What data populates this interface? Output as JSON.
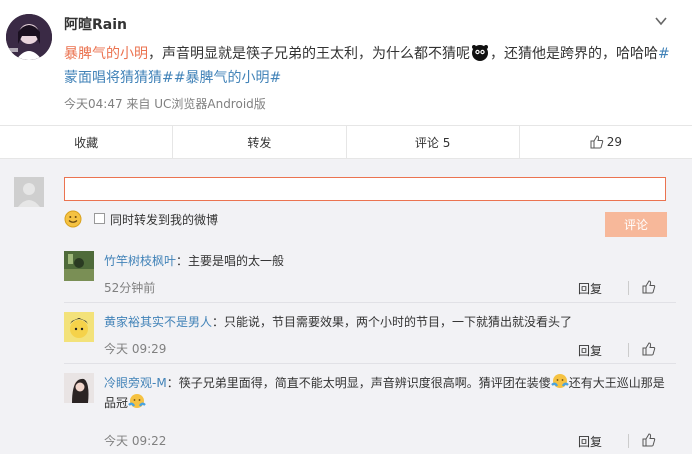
{
  "post": {
    "username": "阿暄Rain",
    "text_tag1": "暴脾气的小明",
    "text_body1": "，声音明显就是筷子兄弟的王太利，为什么都不猜呢",
    "text_body2": "，还猜他是跨界的，哈哈哈",
    "text_tag2": "#蒙面唱将猜猜猜#",
    "text_tag3": "#暴脾气的小明#",
    "meta": "今天04:47 来自 UC浏览器Android版"
  },
  "actions": {
    "favorite": "收藏",
    "forward": "转发",
    "comment": "评论 5",
    "like_count": "29"
  },
  "compose": {
    "input_value": "",
    "forward_label": "同时转发到我的微博",
    "submit_label": "评论"
  },
  "comments": [
    {
      "name": "竹竿树枝枫叶",
      "text": "：主要是唱的太一般",
      "time": "52分钟前",
      "reply": "回复"
    },
    {
      "name": "黄家裕其实不是男人",
      "text": "：只能说，节目需要效果，两个小时的节目，一下就猜出就没看头了",
      "time": "今天 09:29",
      "reply": "回复"
    },
    {
      "name": "冷眼旁观-M",
      "text_a": "：筷子兄弟里面得，简直不能太明显，声音辨识度很高啊。猜评团在装傻",
      "text_b": "还有大王巡山那是品冠",
      "time": "今天 09:22",
      "reply": "回复"
    }
  ],
  "colors": {
    "link_orange": "#eb7350",
    "tag_blue": "#4283b8",
    "button_disabled": "#f7b89a",
    "panel_bg": "#f2f2f5"
  },
  "icons": {
    "more": "chevron-down-icon",
    "like": "thumbs-up-icon",
    "emoji": "smile-icon"
  }
}
